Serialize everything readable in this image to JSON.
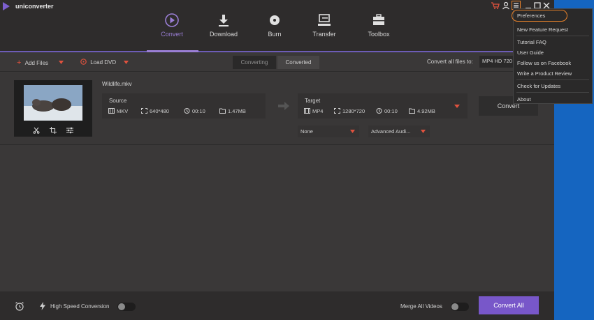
{
  "app": {
    "title": "uniconverter"
  },
  "nav": [
    {
      "id": "convert",
      "label": "Convert",
      "active": true
    },
    {
      "id": "download",
      "label": "Download"
    },
    {
      "id": "burn",
      "label": "Burn"
    },
    {
      "id": "transfer",
      "label": "Transfer"
    },
    {
      "id": "toolbox",
      "label": "Toolbox"
    }
  ],
  "toolbar": {
    "add_files": "Add Files",
    "load_dvd": "Load DVD",
    "tab_converting": "Converting",
    "tab_converted": "Converted",
    "convert_all_files_to": "Convert all files to:",
    "format": "MP4 HD 720"
  },
  "file": {
    "name": "Wildlife.mkv",
    "source": {
      "title": "Source",
      "format": "MKV",
      "resolution": "640*480",
      "duration": "00:10",
      "size": "1.47MB"
    },
    "target": {
      "title": "Target",
      "format": "MP4",
      "resolution": "1280*720",
      "duration": "00:10",
      "size": "4.92MB"
    },
    "subtitle": "None",
    "audio": "Advanced Audi...",
    "convert_label": "Convert"
  },
  "bottom": {
    "high_speed": "High Speed Conversion",
    "merge": "Merge All Videos",
    "convert_all": "Convert All"
  },
  "menu": {
    "items": [
      "Preferences",
      "New Feature Request",
      "Tutorial FAQ",
      "User Guide",
      "Follow us on Facebook",
      "Write a Product Review",
      "Check for Updates",
      "About"
    ]
  },
  "colors": {
    "accent": "#7857c9",
    "highlight": "#e8822a",
    "desktop": "#1565c0"
  }
}
